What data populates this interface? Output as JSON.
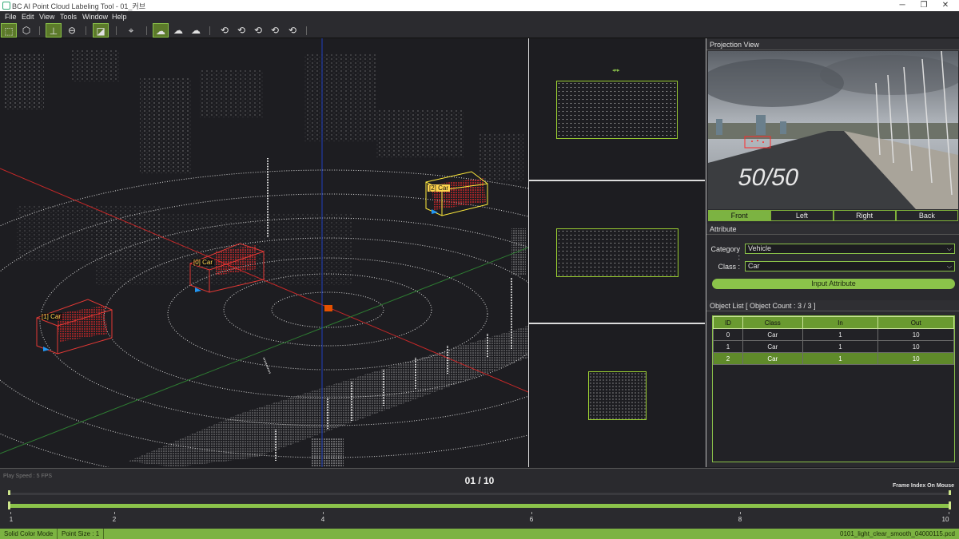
{
  "window": {
    "title": "BC AI Point Cloud Labeling Tool - 01_커브",
    "minimize": "─",
    "maximize": "❐",
    "close": "✕"
  },
  "menu": [
    "File",
    "Edit",
    "View",
    "Tools",
    "Window",
    "Help"
  ],
  "toolbar": [
    {
      "icon": "box-front-icon",
      "glyph": "⬚",
      "active": true
    },
    {
      "icon": "box-3d-icon",
      "glyph": "⬡",
      "active": false
    },
    {
      "icon": "axis-icon",
      "glyph": "⊥",
      "active": true
    },
    {
      "icon": "sphere-icon",
      "glyph": "⊖",
      "active": false
    },
    {
      "icon": "ruler-icon",
      "glyph": "◪",
      "active": true
    },
    {
      "icon": "cursor-select-icon",
      "glyph": "⌖",
      "active": false
    },
    {
      "icon": "cloud-green-icon",
      "glyph": "☁",
      "active": true
    },
    {
      "icon": "cloud-r-icon",
      "glyph": "☁",
      "active": false
    },
    {
      "icon": "cloud-all-icon",
      "glyph": "☁",
      "active": false
    },
    {
      "icon": "rotate-t-icon",
      "glyph": "⟲",
      "active": false
    },
    {
      "icon": "rotate-x-icon",
      "glyph": "⟲",
      "active": false
    },
    {
      "icon": "rotate-x2-icon",
      "glyph": "⟲",
      "active": false
    },
    {
      "icon": "rotate-y-icon",
      "glyph": "⟲",
      "active": false
    },
    {
      "icon": "rotate-y2-icon",
      "glyph": "⟲",
      "active": false
    }
  ],
  "main_view": {
    "objects": [
      {
        "label": "[0] Car"
      },
      {
        "label": "[1] Car"
      },
      {
        "label": "[2] Car"
      }
    ]
  },
  "projection": {
    "header": "Projection View",
    "road_text": "50/50",
    "tabs": [
      "Front",
      "Left",
      "Right",
      "Back"
    ],
    "active_tab": "Front"
  },
  "attribute": {
    "header": "Attribute",
    "category_label": "Category :",
    "category_value": "Vehicle",
    "class_label": "Class :",
    "class_value": "Car",
    "button": "Input Attribute"
  },
  "object_list": {
    "header": "Object List  [ Object Count : 3 / 3 ]",
    "columns": [
      "ID",
      "Class",
      "In",
      "Out"
    ],
    "rows": [
      [
        "0",
        "Car",
        "1",
        "10"
      ],
      [
        "1",
        "Car",
        "1",
        "10"
      ],
      [
        "2",
        "Car",
        "1",
        "10"
      ]
    ],
    "selected_row": 2
  },
  "timeline": {
    "play_speed": "Play Speed : 5 FPS",
    "frame_counter": "01 / 10",
    "mode": "Frame Index On Mouse",
    "ticks": [
      "1",
      "2",
      "4",
      "6",
      "8",
      "10"
    ]
  },
  "status": {
    "color_mode": "Solid Color Mode",
    "point_size": "Point Size : 1",
    "file": "0101_light_clear_smooth_04000115.pcd"
  },
  "colors": {
    "accent": "#8bc34a",
    "bbox": "#e53935",
    "selected_bbox": "#ffeb3b"
  }
}
